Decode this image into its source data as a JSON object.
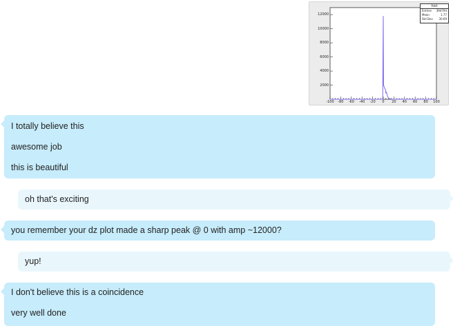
{
  "image_attachment": {
    "stats_box": {
      "title": "hist",
      "rows": [
        {
          "label": "Entries",
          "value": "394794"
        },
        {
          "label": "Mean",
          "value": "1.77"
        },
        {
          "label": "Std Dev",
          "value": "30.69"
        }
      ]
    },
    "y_ticks": [
      "12000",
      "10000",
      "8000",
      "6000",
      "4000",
      "2000"
    ],
    "x_ticks": [
      "-100",
      "-80",
      "-60",
      "-40",
      "-20",
      "0",
      "20",
      "40",
      "60",
      "80",
      "100"
    ]
  },
  "chart_data": {
    "type": "line",
    "title": "hist",
    "xlabel": "",
    "ylabel": "",
    "xlim": [
      -100,
      100
    ],
    "ylim": [
      0,
      13000
    ],
    "x": [
      -100,
      -1,
      0,
      0.5,
      1,
      2,
      3,
      4,
      5,
      6,
      7,
      8,
      9,
      10,
      12,
      15,
      20,
      100
    ],
    "y": [
      0,
      0,
      11800,
      2000,
      1900,
      1700,
      1500,
      1400,
      900,
      1000,
      700,
      400,
      300,
      150,
      80,
      30,
      0,
      0
    ],
    "grid": false,
    "series_color": "#7b68ee"
  },
  "messages": [
    {
      "side": "them",
      "lines": [
        "I totally believe this",
        "awesome job",
        "this is beautiful"
      ]
    },
    {
      "side": "me",
      "lines": [
        "oh that's exciting"
      ]
    },
    {
      "side": "them",
      "lines": [
        "you remember your dz plot made a sharp peak @ 0 with amp ~12000?"
      ]
    },
    {
      "side": "me",
      "lines": [
        "yup!"
      ]
    },
    {
      "side": "them",
      "lines": [
        "I don't believe this is a coincidence",
        "very well done"
      ]
    }
  ]
}
